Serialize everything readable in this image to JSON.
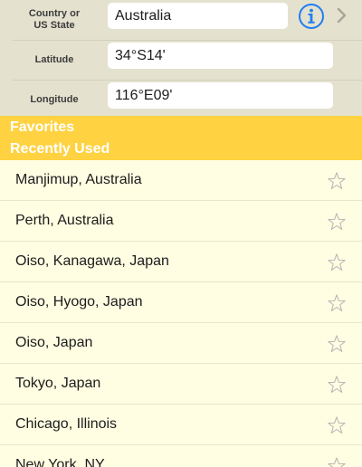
{
  "form": {
    "country": {
      "label_line1": "Country or",
      "label_line2": "US State",
      "value": "Australia"
    },
    "latitude": {
      "label": "Latitude",
      "value": "34°S14'"
    },
    "longitude": {
      "label": "Longitude",
      "value": "116°E09'"
    }
  },
  "sections": {
    "favorites": "Favorites",
    "recently_used": "Recently Used"
  },
  "recent_locations": [
    "Manjimup, Australia",
    "Perth, Australia",
    "Oiso, Kanagawa, Japan",
    "Oiso, Hyogo, Japan",
    "Oiso, Japan",
    "Tokyo, Japan",
    "Chicago, Illinois",
    "New York, NY"
  ],
  "colors": {
    "form_background": "#e4e1cf",
    "header_background": "#fed241",
    "list_background": "#fffde2",
    "accent_blue": "#1f7ef3",
    "star_outline": "#b5b5b5"
  },
  "icons": {
    "info": "info-icon",
    "chevron": "chevron-right-icon",
    "favorite": "star-outline-icon"
  }
}
